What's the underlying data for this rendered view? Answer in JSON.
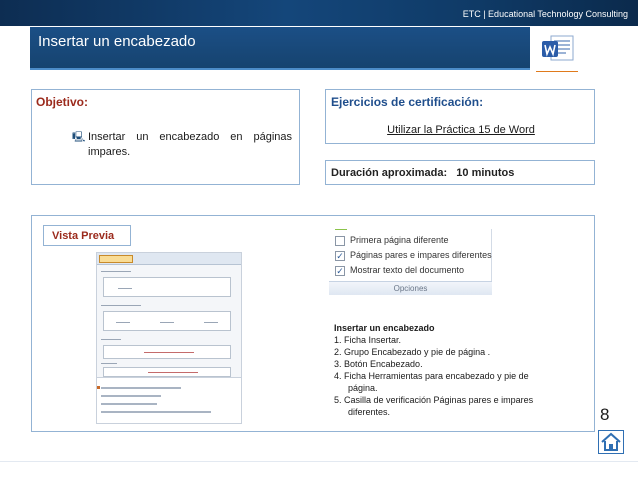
{
  "header": {
    "brand": "ETC | Educational Technology Consulting",
    "title": "Insertar un encabezado"
  },
  "objetivo": {
    "label": "Objetivo:",
    "item": "Insertar un encabezado en páginas impares."
  },
  "ejercicios": {
    "label": "Ejercicios de certificación:",
    "link": "Utilizar la Práctica 15 de Word"
  },
  "duracion": {
    "label": "Duración aproximada:   10 minutos"
  },
  "preview": {
    "label": "Vista Previa"
  },
  "options_panel": {
    "rows": [
      {
        "label": "Primera página diferente",
        "checked": false
      },
      {
        "label": "Páginas pares e impares diferentes",
        "checked": true
      },
      {
        "label": "Mostrar texto del documento",
        "checked": true
      }
    ],
    "footer": "Opciones"
  },
  "steps": {
    "title": "Insertar un encabezado",
    "items": [
      "1.   Ficha Insertar.",
      "2.   Grupo  Encabezado y pie de página .",
      "3.   Botón Encabezado.",
      "4.   Ficha Herramientas para encabezado y pie de página.",
      "5.   Casilla de verificación Páginas pares e impares diferentes."
    ]
  },
  "page_number": "8",
  "icons": {
    "logo": "word-logo-icon",
    "home": "home-icon",
    "bullet": "computer-bullet-icon"
  },
  "colors": {
    "header_blue": "#16436f",
    "label_red": "#9b2a1c",
    "label_blue": "#1f4e8c",
    "border": "#93b3d4"
  }
}
